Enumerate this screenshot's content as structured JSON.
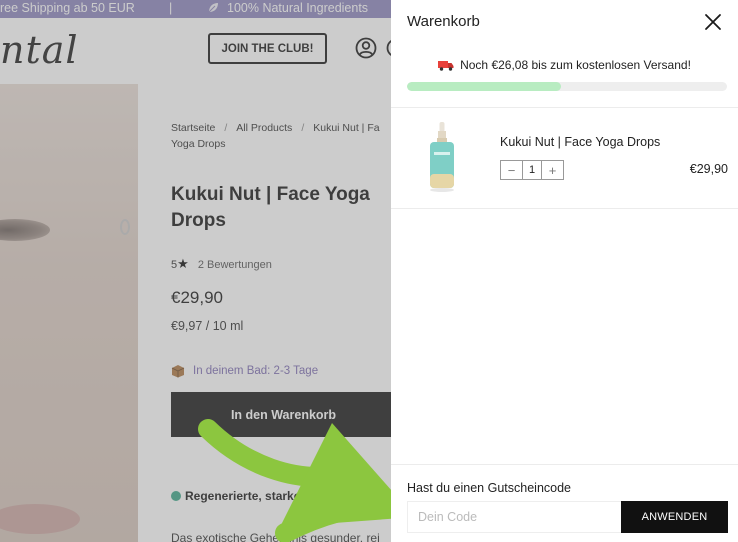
{
  "announcement": {
    "left_text": "ree Shipping ab 50 EUR",
    "separator": "|",
    "right_text": "100% Natural Ingredients"
  },
  "header": {
    "logo_text": "ntal",
    "club_button": "JOIN THE CLUB!"
  },
  "product": {
    "breadcrumb": [
      {
        "label": "Startseite"
      },
      {
        "label": "All Products"
      },
      {
        "label": "Kukui Nut | Fa"
      }
    ],
    "breadcrumb_tail": "Yoga Drops",
    "breadcrumb_sep": "/",
    "title": "Kukui Nut | Face Yoga Drops",
    "rating_value": "5",
    "rating_star": "★",
    "reviews_text": "2 Bewertungen",
    "price": "€29,90",
    "unit_price": "€9,97 / 10 ml",
    "delivery_text": "In deinem Bad: 2-3 Tage",
    "add_to_cart": "In den Warenkorb",
    "benefit_text": "Regenerierte, starke Hau",
    "description_text": "Das exotische Geheimnis gesunder, rei"
  },
  "cart": {
    "title": "Warenkorb",
    "shipping_message": "Noch €26,08 bis zum kostenlosen Versand!",
    "shipping_progress": 0.48,
    "items": [
      {
        "name": "Kukui Nut | Face Yoga Drops",
        "quantity": "1",
        "price": "€29,90"
      }
    ],
    "qty_minus": "−",
    "qty_plus": "+",
    "coupon_label": "Hast du einen Gutscheincode",
    "coupon_placeholder": "Dein Code",
    "coupon_value": "",
    "apply_button": "ANWENDEN"
  },
  "colors": {
    "announcement_bg": "#8e88bf",
    "delivery_text": "#7f6fb4",
    "progress_fill": "#b8ecc1",
    "arrow": "#8cc63f",
    "benefit_dot": "#3fa98c"
  }
}
